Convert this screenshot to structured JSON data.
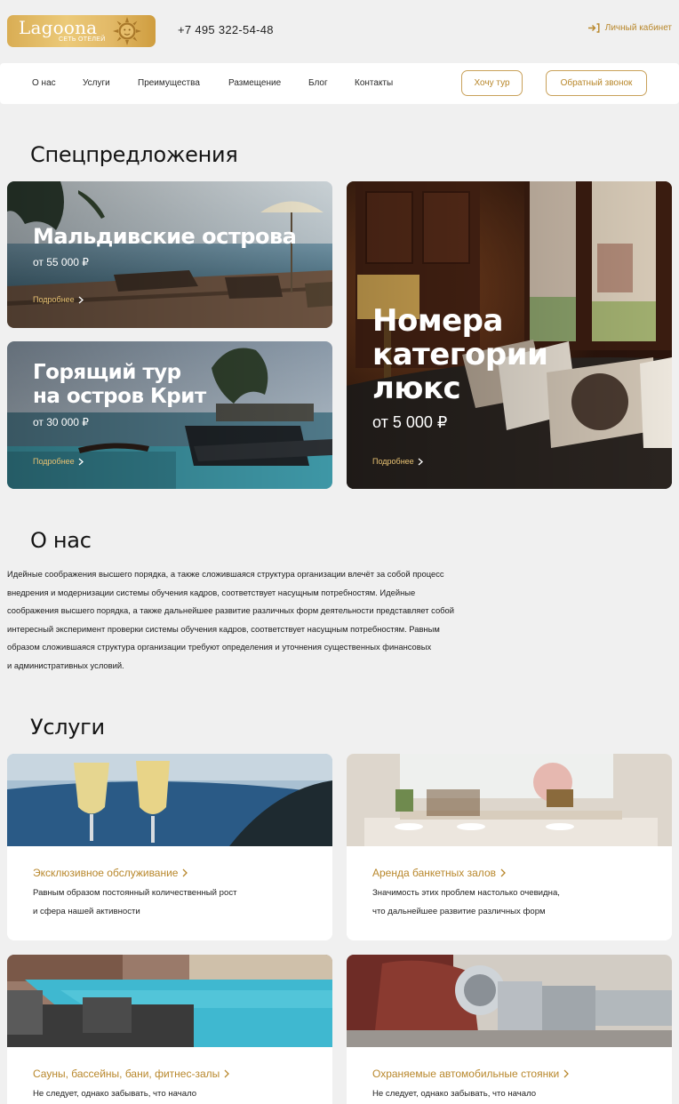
{
  "header": {
    "logo_word": "Lagoona",
    "logo_tagline": "СЕТЬ ОТЕЛЕЙ",
    "phone": "+7 495 322-54-48",
    "cabinet_label": "Личный кабинет"
  },
  "nav": {
    "items": [
      "О нас",
      "Услуги",
      "Преимущества",
      "Размещение",
      "Блог",
      "Контакты"
    ],
    "tour_button": "Хочу тур",
    "callback_button": "Обратный звонок"
  },
  "offers": {
    "heading": "Спецпредложения",
    "items": [
      {
        "title": "Мальдивские острова",
        "price": "от 55 000 ₽",
        "more": "Подробнее"
      },
      {
        "title_line1": "Горящий тур",
        "title_line2": "на остров Крит",
        "price": "от 30 000 ₽",
        "more": "Подробнее"
      },
      {
        "title_line1": "Номера",
        "title_line2": "категории",
        "title_line3": "люкс",
        "price": "от 5 000 ₽",
        "more": "Подробнее"
      }
    ]
  },
  "about": {
    "heading": "О нас",
    "lines": [
      "Идейные соображения высшего порядка, а также сложившаяся структура организации влечёт за собой процесс",
      "внедрения и модернизации системы обучения кадров, соответствует насущным потребностям. Идейные",
      "соображения высшего порядка, а также дальнейшее развитие различных форм деятельности представляет собой",
      "интересный эксперимент проверки системы обучения кадров, соответствует насущным потребностям. Равным",
      "образом сложившаяся структура организации требуют определения и уточнения существенных финансовых",
      "и административных условий."
    ]
  },
  "services": {
    "heading": "Услуги",
    "items": [
      {
        "title": "Эксклюзивное обслуживание",
        "line1": "Равным образом постоянный количественный рост",
        "line2": "и сфера нашей активности"
      },
      {
        "title": "Аренда банкетных залов",
        "line1": "Значимость этих проблем настолько очевидна,",
        "line2": "что дальнейшее развитие различных форм"
      },
      {
        "title": "Сауны, бассейны, бани, фитнес-залы",
        "line1": "Не следует, однако забывать, что начало",
        "line2": ""
      },
      {
        "title": "Охраняемые автомобильные стоянки",
        "line1": "Не следует, однако забывать, что начало",
        "line2": ""
      }
    ]
  },
  "colors": {
    "accent": "#b8872b",
    "accent_light": "#e7c172",
    "background": "#f0f0f0",
    "logo_gold": "#d9ad54"
  },
  "icons": [
    "sun-face-icon",
    "login-arrow-icon",
    "chevron-right-icon"
  ]
}
